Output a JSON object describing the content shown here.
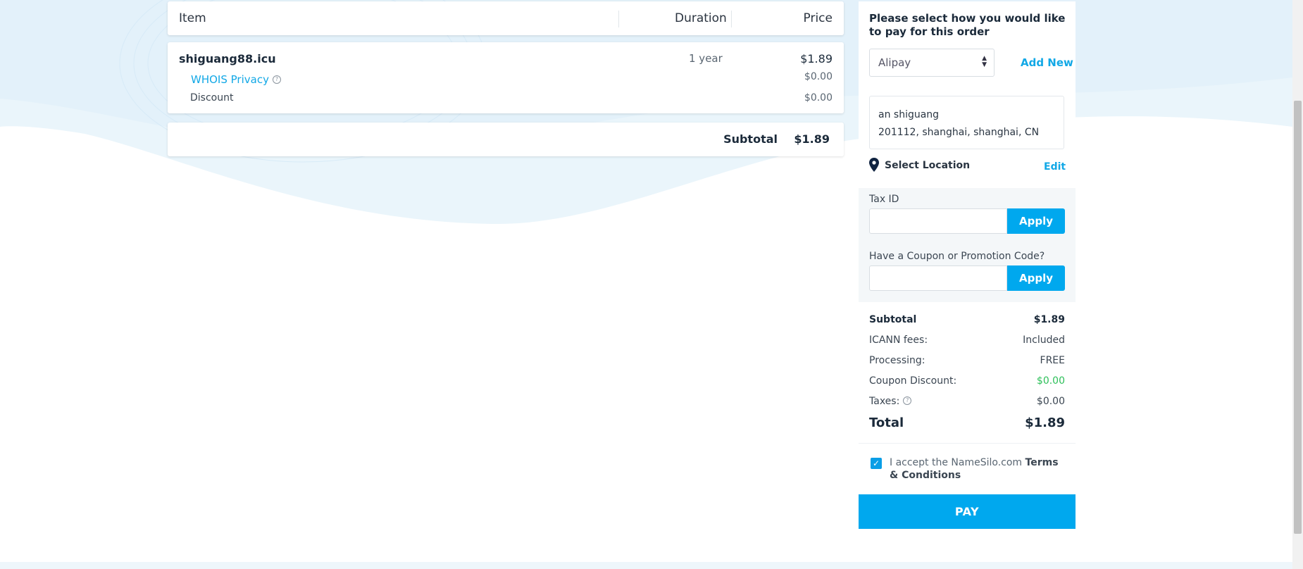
{
  "order_table": {
    "header": {
      "item": "Item",
      "duration": "Duration",
      "price": "Price"
    },
    "domain": {
      "name": "shiguang88.icu",
      "duration": "1 year",
      "price": "$1.89"
    },
    "whois": {
      "label": "WHOIS Privacy",
      "price": "$0.00"
    },
    "discount": {
      "label": "Discount",
      "price": "$0.00"
    },
    "subtotal": {
      "label": "Subtotal",
      "value": "$1.89"
    }
  },
  "payment": {
    "title": "Please select how you would like to pay for this order",
    "method": "Alipay",
    "add_new": "Add New"
  },
  "address": {
    "name": "an shiguang",
    "line": "201112, shanghai, shanghai, CN",
    "select_location": "Select Location",
    "edit": "Edit"
  },
  "tax": {
    "label": "Tax ID",
    "apply": "Apply",
    "value": ""
  },
  "coupon": {
    "label": "Have a Coupon or Promotion Code?",
    "apply": "Apply",
    "value": ""
  },
  "summary": {
    "subtotal_label": "Subtotal",
    "subtotal_value": "$1.89",
    "icann_label": "ICANN fees:",
    "icann_value": "Included",
    "processing_label": "Processing:",
    "processing_value": "FREE",
    "coupon_label": "Coupon Discount:",
    "coupon_value": "$0.00",
    "taxes_label": "Taxes:",
    "taxes_value": "$0.00",
    "total_label": "Total",
    "total_value": "$1.89"
  },
  "terms": {
    "prefix": "I accept the NameSilo.com",
    "link": "Terms & Conditions",
    "checked": true
  },
  "pay_button": "PAY",
  "colors": {
    "accent": "#00a8ee",
    "link": "#12a8e6",
    "green": "#2ec05a",
    "wave": "#e8f4fb"
  },
  "icons": {
    "location": "map-pin-icon",
    "help": "question-circle-icon",
    "check": "checkmark-icon",
    "select": "sort-arrows-icon"
  }
}
